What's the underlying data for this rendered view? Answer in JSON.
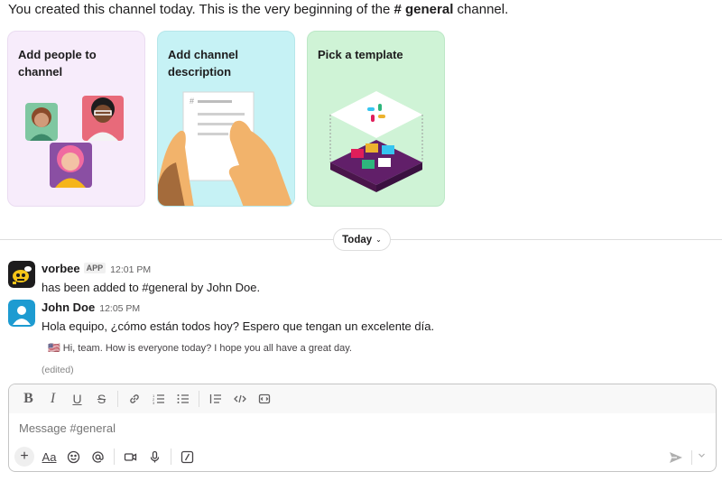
{
  "intro": {
    "before": "You created this channel today. This is the very beginning of the ",
    "channel": "# general",
    "after": " channel."
  },
  "cards": [
    {
      "title": "Add people to channel"
    },
    {
      "title": "Add channel description"
    },
    {
      "title": "Pick a template"
    }
  ],
  "divider": {
    "label": "Today",
    "chevron": "⌄"
  },
  "messages": [
    {
      "sender": "vorbee",
      "badge": "APP",
      "time": "12:01 PM",
      "text": "has been added to #general by John Doe.",
      "avatar_icon": "bee-bot-avatar-icon"
    },
    {
      "sender": "John Doe",
      "time": "12:05 PM",
      "text": "Hola equipo, ¿cómo están todos hoy? Espero que tengan un excelente día.",
      "translation_flag": "🇺🇸",
      "translation": "Hi, team. How is everyone today? I hope you all have a great day.",
      "edited": "(edited)",
      "avatar_icon": "default-user-avatar-icon"
    }
  ],
  "composer": {
    "placeholder": "Message #general",
    "format_buttons": {
      "bold": "B",
      "italic": "I",
      "underline": "U",
      "strike": "S"
    },
    "text_format_label": "Aa",
    "plus_label": "+"
  },
  "colors": {
    "card_people": "#f7ecfb",
    "card_description": "#c6f2f5",
    "card_template": "#cff3d6",
    "avatar_blue": "#1d9bd1"
  }
}
